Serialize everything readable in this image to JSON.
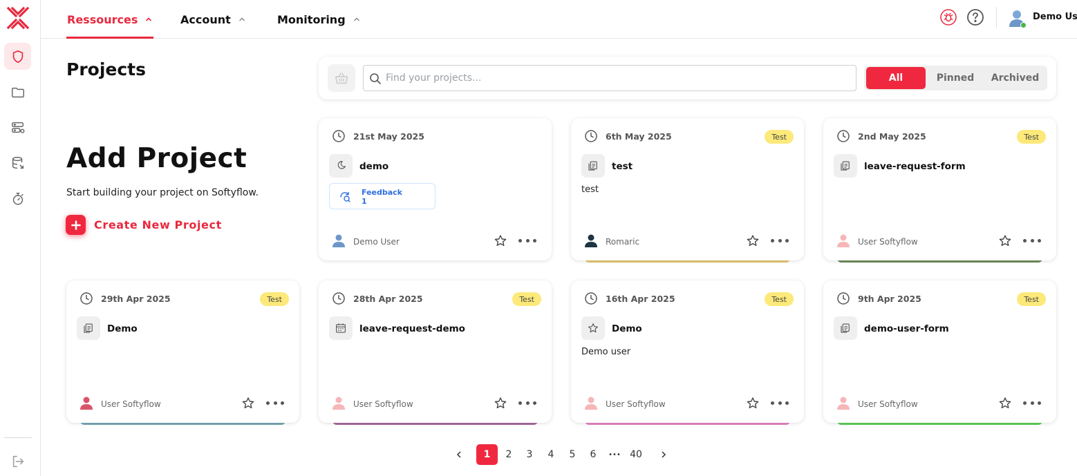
{
  "sidebar": {
    "logo_icon": "softyflow-x-logo-icon",
    "items": [
      {
        "icon": "shield-icon",
        "active": true
      },
      {
        "icon": "folder-icon",
        "active": false
      },
      {
        "icon": "server-settings-icon",
        "active": false
      },
      {
        "icon": "database-icon",
        "active": false
      },
      {
        "icon": "timer-icon",
        "active": false
      }
    ],
    "logout_icon": "logout-icon"
  },
  "topnav": {
    "tabs": [
      {
        "label": "Ressources",
        "active": true
      },
      {
        "label": "Account",
        "active": false
      },
      {
        "label": "Monitoring",
        "active": false
      }
    ],
    "right_icons": [
      "bug-icon",
      "help-icon"
    ],
    "user_name": "Demo Us",
    "user_status": "online"
  },
  "left": {
    "title": "Projects",
    "add_title": "Add Project",
    "add_subtitle": "Start building your project on Softyflow.",
    "create_label": "Create New Project"
  },
  "search": {
    "placeholder": "Find your projects...",
    "value": "",
    "filters": [
      {
        "label": "All",
        "active": true
      },
      {
        "label": "Pinned",
        "active": false
      },
      {
        "label": "Archived",
        "active": false
      }
    ]
  },
  "projects": [
    {
      "date": "21st May 2025",
      "tag": "",
      "icon": "moon-icon",
      "name": "demo",
      "description": "",
      "feedback_label": "Feedback",
      "feedback_count": "1",
      "owner": "Demo User",
      "owner_color": "#6e97c9",
      "stripe": ""
    },
    {
      "date": "6th May 2025",
      "tag": "Test",
      "icon": "copy-icon",
      "name": "test",
      "description": "test",
      "owner": "Romaric",
      "owner_color": "#1d3442",
      "stripe": "#e4c770"
    },
    {
      "date": "2nd May 2025",
      "tag": "Test",
      "icon": "copy-icon",
      "name": "leave-request-form",
      "description": "",
      "owner": "User Softyflow",
      "owner_color": "#f6b6b8",
      "stripe": "#6f8c5a"
    },
    {
      "date": "29th Apr 2025",
      "tag": "Test",
      "icon": "copy-icon",
      "name": "Demo",
      "description": "",
      "owner": "User Softyflow",
      "owner_color": "#d9546a",
      "stripe": "#7aa9b4"
    },
    {
      "date": "28th Apr 2025",
      "tag": "Test",
      "icon": "calendar-icon",
      "name": "leave-request-demo",
      "description": "",
      "owner": "User Softyflow",
      "owner_color": "#f6b6b8",
      "stripe": "#a96b9f"
    },
    {
      "date": "16th Apr 2025",
      "tag": "Test",
      "icon": "star-icon",
      "name": "Demo",
      "description": "Demo user",
      "owner": "User Softyflow",
      "owner_color": "#f6b6b8",
      "stripe": "#e783c2"
    },
    {
      "date": "9th Apr 2025",
      "tag": "Test",
      "icon": "copy-icon",
      "name": "demo-user-form",
      "description": "",
      "owner": "User Softyflow",
      "owner_color": "#f6b6b8",
      "stripe": "#5fcf5a"
    }
  ],
  "pagination": {
    "prev_icon": "chevron-left-icon",
    "pages": [
      "1",
      "2",
      "3",
      "4",
      "5",
      "6"
    ],
    "ellipsis": "•••",
    "last": "40",
    "current": "1",
    "next_icon": "chevron-right-icon"
  },
  "colors": {
    "accent": "#f0283f",
    "accent_text": "#e8293e",
    "tag_bg": "#fce97a",
    "active_side_bg": "#fde8ea"
  }
}
